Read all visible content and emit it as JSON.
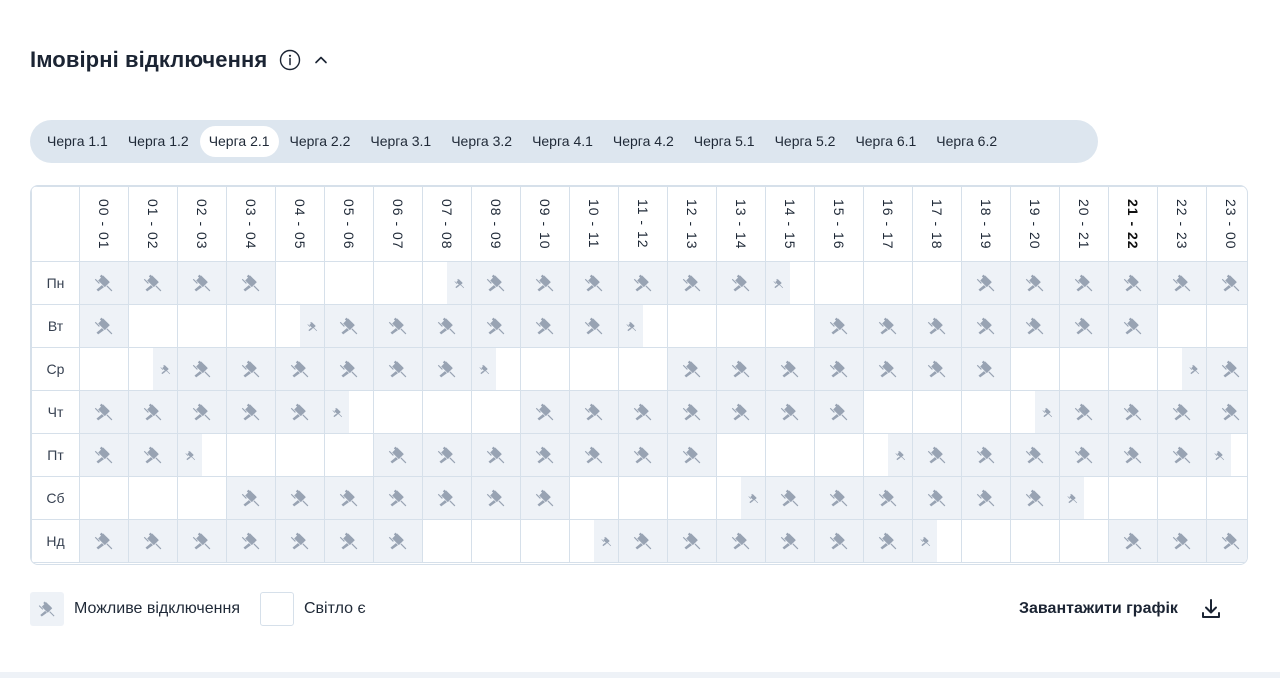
{
  "header": {
    "title": "Імовірні відключення",
    "info_icon": "info-icon",
    "collapse_icon": "chevron-up-icon"
  },
  "tabs": [
    {
      "label": "Черга 1.1",
      "active": false
    },
    {
      "label": "Черга 1.2",
      "active": false
    },
    {
      "label": "Черга 2.1",
      "active": true
    },
    {
      "label": "Черга 2.2",
      "active": false
    },
    {
      "label": "Черга 3.1",
      "active": false
    },
    {
      "label": "Черга 3.2",
      "active": false
    },
    {
      "label": "Черга 4.1",
      "active": false
    },
    {
      "label": "Черга 4.2",
      "active": false
    },
    {
      "label": "Черга 5.1",
      "active": false
    },
    {
      "label": "Черга 5.2",
      "active": false
    },
    {
      "label": "Черга 6.1",
      "active": false
    },
    {
      "label": "Черга 6.2",
      "active": false
    }
  ],
  "schedule": {
    "hours": [
      "00 - 01",
      "01 - 02",
      "02 - 03",
      "03 - 04",
      "04 - 05",
      "05 - 06",
      "06 - 07",
      "07 - 08",
      "08 - 09",
      "09 - 10",
      "10 - 11",
      "11 - 12",
      "12 - 13",
      "13 - 14",
      "14 - 15",
      "15 - 16",
      "16 - 17",
      "17 - 18",
      "18 - 19",
      "19 - 20",
      "20 - 21",
      "21 - 22",
      "22 - 23",
      "23 - 00"
    ],
    "current_hour_index": 21,
    "legend_codes": {
      "F": "full hour outage",
      "R": "outage second half",
      "L": "outage first half",
      "N": "power on"
    },
    "rows": [
      {
        "day": "Пн",
        "cells": [
          "F",
          "F",
          "F",
          "F",
          "N",
          "N",
          "N",
          "R",
          "F",
          "F",
          "F",
          "F",
          "F",
          "F",
          "L",
          "N",
          "N",
          "N",
          "F",
          "F",
          "F",
          "F",
          "F",
          "F"
        ]
      },
      {
        "day": "Вт",
        "cells": [
          "F",
          "N",
          "N",
          "N",
          "R",
          "F",
          "F",
          "F",
          "F",
          "F",
          "F",
          "L",
          "N",
          "N",
          "N",
          "F",
          "F",
          "F",
          "F",
          "F",
          "F",
          "F",
          "N",
          "N"
        ]
      },
      {
        "day": "Ср",
        "cells": [
          "N",
          "R",
          "F",
          "F",
          "F",
          "F",
          "F",
          "F",
          "L",
          "N",
          "N",
          "N",
          "F",
          "F",
          "F",
          "F",
          "F",
          "F",
          "F",
          "N",
          "N",
          "N",
          "R",
          "F"
        ]
      },
      {
        "day": "Чт",
        "cells": [
          "F",
          "F",
          "F",
          "F",
          "F",
          "L",
          "N",
          "N",
          "N",
          "F",
          "F",
          "F",
          "F",
          "F",
          "F",
          "F",
          "N",
          "N",
          "N",
          "R",
          "F",
          "F",
          "F",
          "F"
        ]
      },
      {
        "day": "Пт",
        "cells": [
          "F",
          "F",
          "L",
          "N",
          "N",
          "N",
          "F",
          "F",
          "F",
          "F",
          "F",
          "F",
          "F",
          "N",
          "N",
          "N",
          "R",
          "F",
          "F",
          "F",
          "F",
          "F",
          "F",
          "L"
        ]
      },
      {
        "day": "Сб",
        "cells": [
          "N",
          "N",
          "N",
          "F",
          "F",
          "F",
          "F",
          "F",
          "F",
          "F",
          "N",
          "N",
          "N",
          "R",
          "F",
          "F",
          "F",
          "F",
          "F",
          "F",
          "L",
          "N",
          "N",
          "N"
        ]
      },
      {
        "day": "Нд",
        "cells": [
          "F",
          "F",
          "F",
          "F",
          "F",
          "F",
          "F",
          "N",
          "N",
          "N",
          "R",
          "F",
          "F",
          "F",
          "F",
          "F",
          "F",
          "L",
          "N",
          "N",
          "N",
          "F",
          "F",
          "F"
        ]
      }
    ]
  },
  "legend": {
    "outage_label": "Можливе відключення",
    "power_label": "Світло є"
  },
  "download": {
    "label": "Завантажити графік",
    "icon": "download-icon"
  },
  "colors": {
    "outage_bg": "#eef2f7",
    "grid_border": "#d6e0ea",
    "icon": "#98a3b3",
    "tabs_bg": "#dde6ef"
  }
}
